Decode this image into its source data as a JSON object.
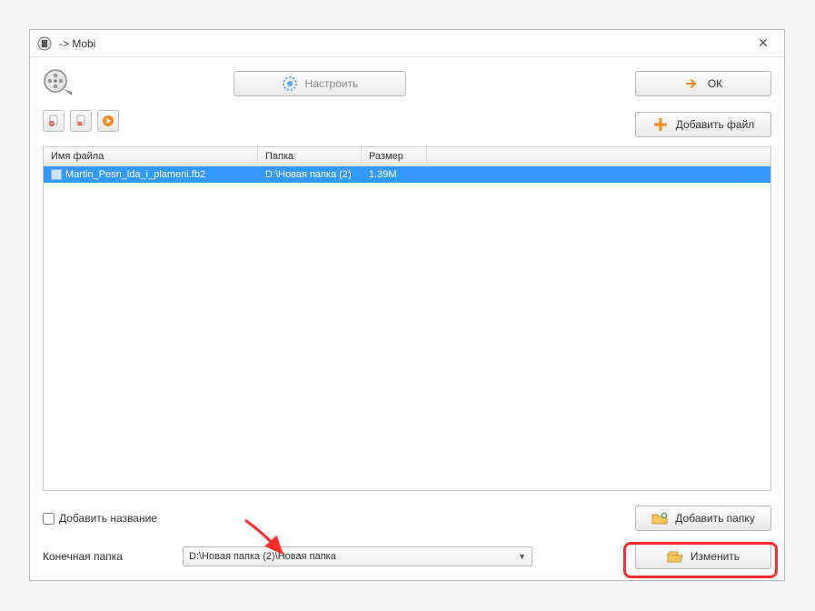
{
  "window": {
    "title": "-> Mobi"
  },
  "toolbar": {
    "configure_label": "Настроить",
    "ok_label": "ОК",
    "add_file_label": "Добавить файл"
  },
  "table": {
    "headers": {
      "filename": "Имя файла",
      "folder": "Папка",
      "size": "Размер"
    },
    "rows": [
      {
        "filename": "Martin_Pesn_lda_i_plameni.fb2",
        "folder": "D:\\Новая папка (2)",
        "size": "1.39M",
        "selected": true
      }
    ]
  },
  "footer": {
    "add_title_label": "Добавить название",
    "add_folder_label": "Добавить папку",
    "final_folder_label": "Конечная папка",
    "final_folder_value": "D:\\Новая папка (2)\\Новая папка",
    "change_label": "Изменить"
  }
}
